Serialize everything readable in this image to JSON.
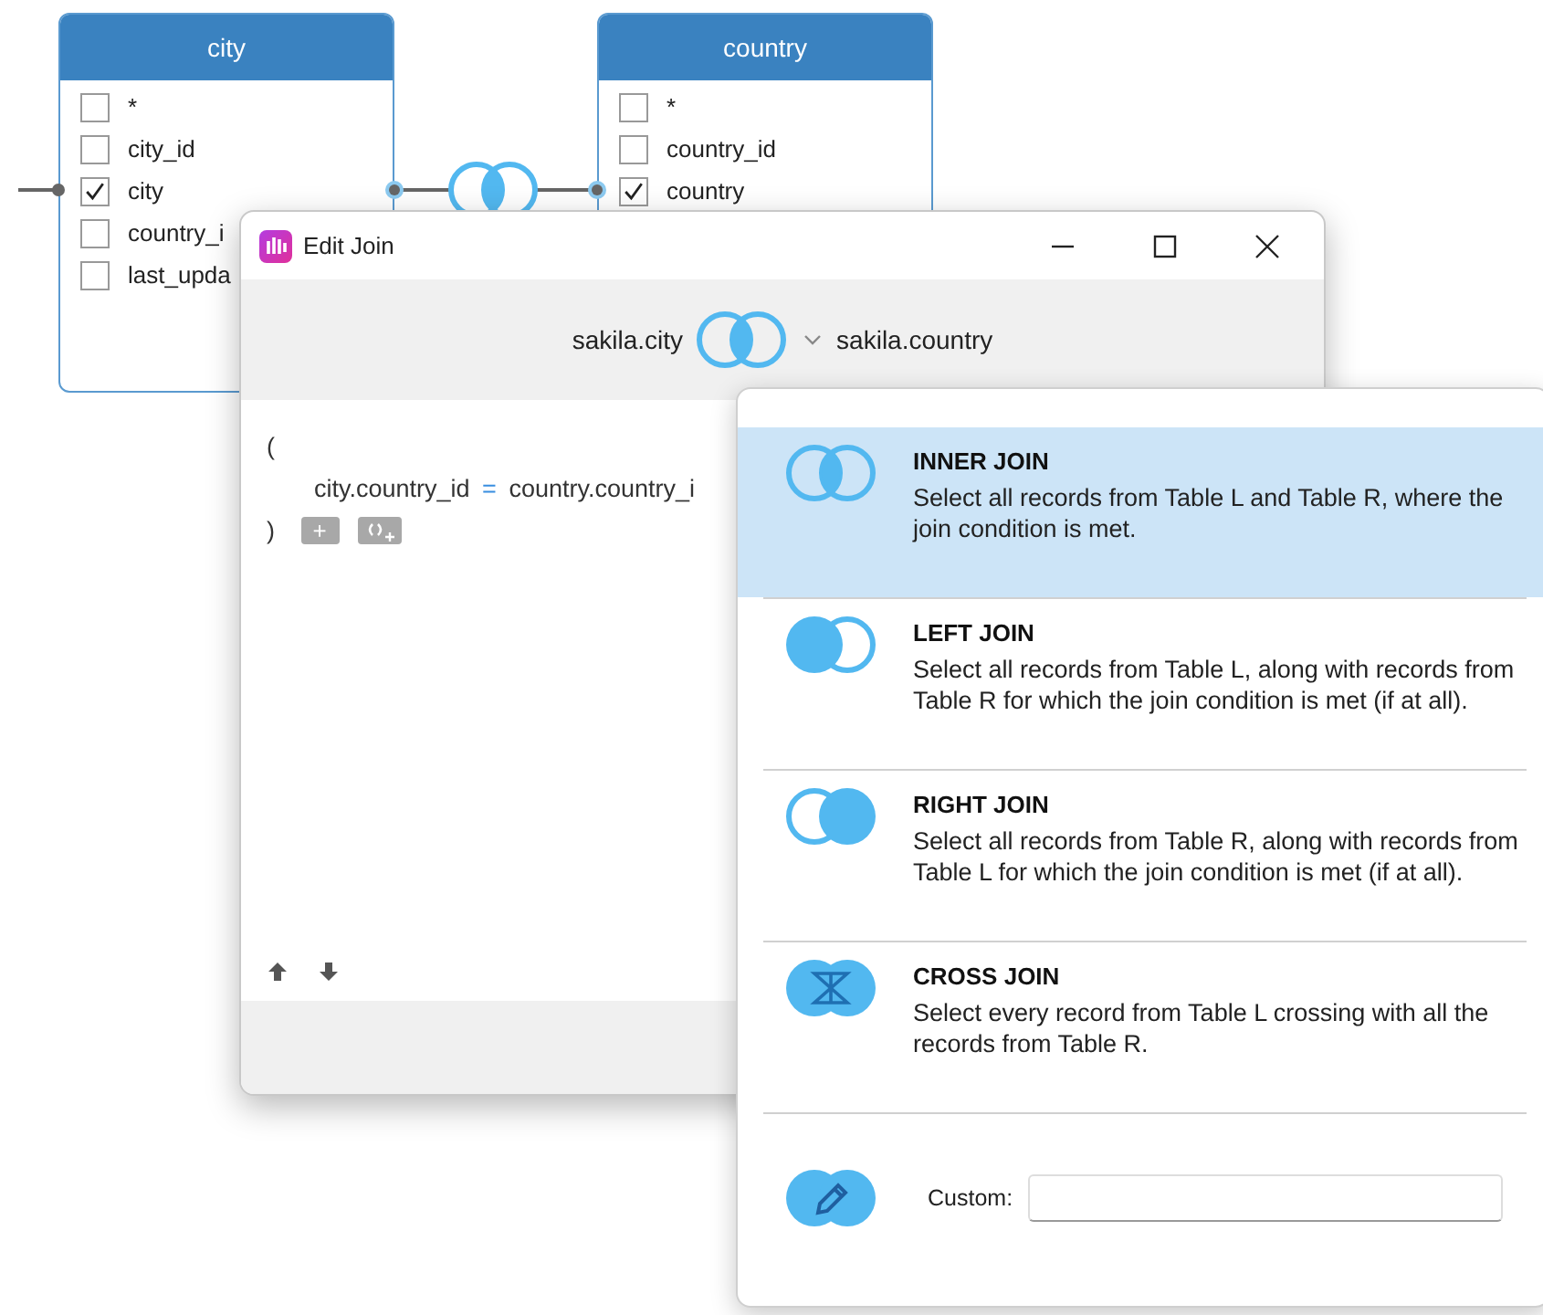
{
  "tables": [
    {
      "title": "city",
      "columns": [
        {
          "name": "*",
          "checked": false
        },
        {
          "name": "city_id",
          "checked": false
        },
        {
          "name": "city",
          "checked": true
        },
        {
          "name": "country_i",
          "checked": false
        },
        {
          "name": "last_upda",
          "checked": false
        }
      ]
    },
    {
      "title": "country",
      "columns": [
        {
          "name": "*",
          "checked": false
        },
        {
          "name": "country_id",
          "checked": false
        },
        {
          "name": "country",
          "checked": true
        }
      ]
    }
  ],
  "dialog": {
    "title": "Edit Join",
    "left_table": "sakila.city",
    "right_table": "sakila.country",
    "condition": {
      "open": "(",
      "left": "city.country_id",
      "operator": "=",
      "right": "country.country_i",
      "close": ")",
      "add_button": "+"
    }
  },
  "join_menu": {
    "options": [
      {
        "kind": "inner",
        "title": "INNER JOIN",
        "description": "Select all records from Table L and Table R, where the join condition is met.",
        "selected": true
      },
      {
        "kind": "left",
        "title": "LEFT JOIN",
        "description": "Select all records from Table L, along with records from Table R for which the join condition is met (if at all).",
        "selected": false
      },
      {
        "kind": "right",
        "title": "RIGHT JOIN",
        "description": "Select all records from Table R, along with records from Table L for which the join condition is met (if at all).",
        "selected": false
      },
      {
        "kind": "cross",
        "title": "CROSS JOIN",
        "description": "Select every record from Table L crossing with all the records from Table R.",
        "selected": false
      }
    ],
    "custom": {
      "label": "Custom:"
    }
  }
}
